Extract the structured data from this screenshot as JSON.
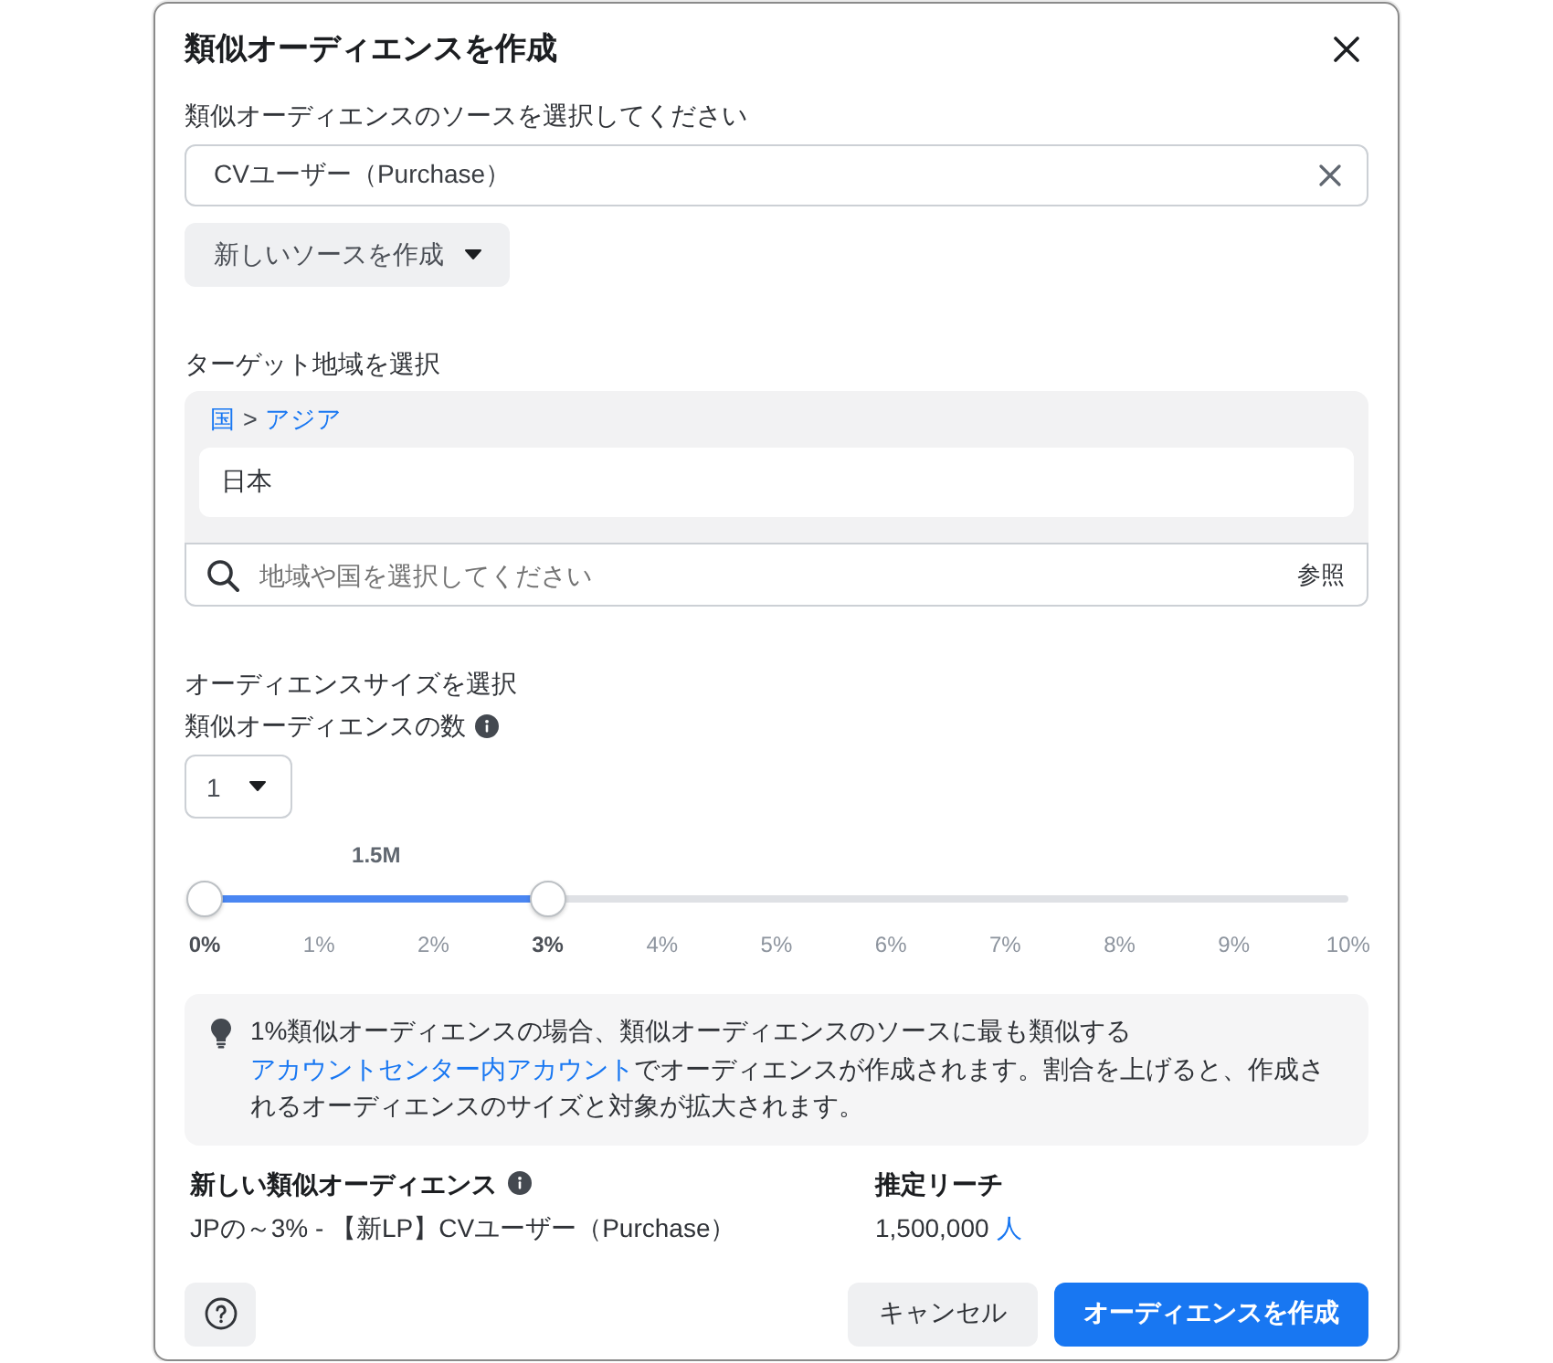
{
  "dialog": {
    "title": "類似オーディエンスを作成"
  },
  "source": {
    "label": "類似オーディエンスのソースを選択してください",
    "value": "CVユーザー（Purchase）",
    "create_button": "新しいソースを作成"
  },
  "location": {
    "label": "ターゲット地域を選択",
    "breadcrumb": [
      "国",
      "アジア"
    ],
    "breadcrumb_separator": ">",
    "selected": [
      "日本"
    ],
    "search": {
      "placeholder": "地域や国を選択してください",
      "browse": "参照"
    }
  },
  "size": {
    "label": "オーディエンスサイズを選択",
    "count_label": "類似オーディエンスの数",
    "count_value": "1",
    "slider": {
      "reading": "1.5M",
      "thumbs": [
        {
          "level": 0
        },
        {
          "level": 0.3
        }
      ],
      "ticks": [
        {
          "label": "0%",
          "selected": true
        },
        {
          "label": "1%",
          "selected": false
        },
        {
          "label": "2%",
          "selected": false
        },
        {
          "label": "3%",
          "selected": true
        },
        {
          "label": "4%",
          "selected": false
        },
        {
          "label": "5%",
          "selected": false
        },
        {
          "label": "6%",
          "selected": false
        },
        {
          "label": "7%",
          "selected": false
        },
        {
          "label": "8%",
          "selected": false
        },
        {
          "label": "9%",
          "selected": false
        },
        {
          "label": "10%",
          "selected": false
        }
      ]
    }
  },
  "info": {
    "parts": [
      {
        "kind": "text",
        "text": "1%類似オーディエンスの場合、類似オーディエンスのソースに最も類似する"
      },
      {
        "kind": "link",
        "text": "アカウントセンター内アカウント"
      },
      {
        "kind": "text",
        "text": "でオーディエンスが作成されます。割合を上げると、作成されるオーディエンスのサイズと対象が拡大されます。"
      }
    ]
  },
  "summary": {
    "name_label": "新しい類似オーディエンス",
    "name": "JPの～3% - 【新LP】CVユーザー（Purchase）",
    "reach_label": "推定リーチ",
    "reach": "1,500,000",
    "reach_unit": "人"
  },
  "buttons": [
    {
      "kind": "secondary",
      "label": "キャンセル"
    },
    {
      "kind": "primary",
      "label": "オーディエンスを作成"
    }
  ]
}
